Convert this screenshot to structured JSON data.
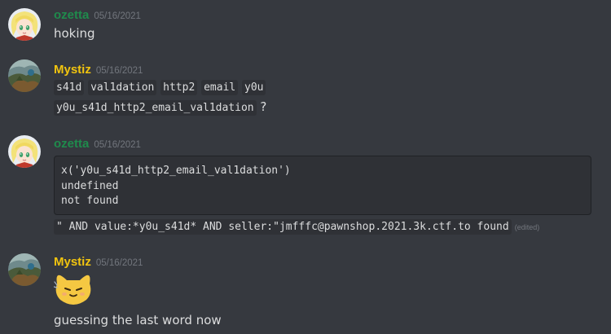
{
  "colors": {
    "background": "#36393f",
    "ozetta_name": "#1f8b4c",
    "mystiz_name": "#f1c40f",
    "timestamp": "#72767d",
    "text": "#dcddde",
    "code_bg": "#2f3136"
  },
  "messages": [
    {
      "author": "ozetta",
      "timestamp": "05/16/2021",
      "avatar_icon": "anime-girl-avatar",
      "text": "hoking"
    },
    {
      "author": "Mystiz",
      "timestamp": "05/16/2021",
      "avatar_icon": "landscape-avatar",
      "inline_codes": [
        "s41d",
        "val1dation",
        "http2",
        "email",
        "y0u"
      ],
      "line2_code": "y0u_s41d_http2_email_val1dation",
      "line2_suffix": "?"
    },
    {
      "author": "ozetta",
      "timestamp": "05/16/2021",
      "avatar_icon": "anime-girl-avatar",
      "code_block": [
        "x('y0u_s41d_http2_email_val1dation')",
        "undefined",
        "not found"
      ],
      "query_line": "\" AND value:*y0u_s41d* AND seller:\"jmfffc@pawnshop.2021.3k.ctf.to found",
      "edited_label": "(edited)"
    },
    {
      "author": "Mystiz",
      "timestamp": "05/16/2021",
      "avatar_icon": "landscape-avatar",
      "emoji": "blob-cat-sleepy-emoji",
      "text": "guessing the last word now"
    }
  ]
}
